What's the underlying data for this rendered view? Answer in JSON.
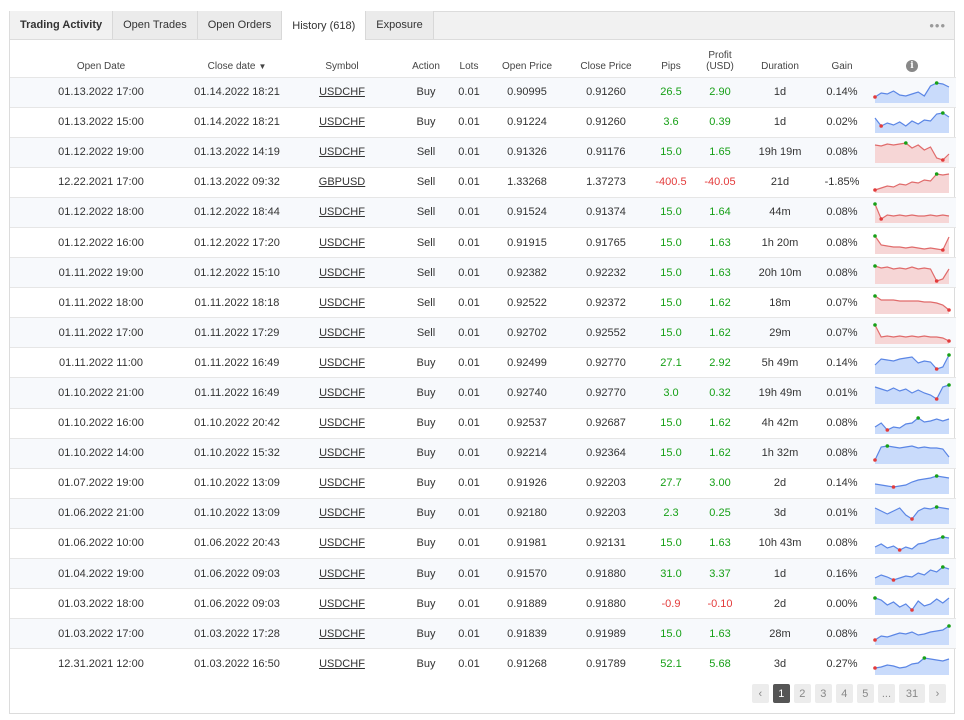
{
  "tabs": [
    {
      "label": "Trading Activity"
    },
    {
      "label": "Open Trades"
    },
    {
      "label": "Open Orders"
    },
    {
      "label": "History (618)"
    },
    {
      "label": "Exposure"
    }
  ],
  "more_label": "•••",
  "columns": {
    "open_date": "Open Date",
    "close_date": "Close date",
    "sort_caret": "▼",
    "symbol": "Symbol",
    "action": "Action",
    "lots": "Lots",
    "open_price": "Open Price",
    "close_price": "Close Price",
    "pips": "Pips",
    "profit_line1": "Profit",
    "profit_line2": "(USD)",
    "duration": "Duration",
    "gain": "Gain",
    "info_icon": "i"
  },
  "colors": {
    "positive": "#17a017",
    "negative": "#e33b3b",
    "buy_fill": "#c9dbfb",
    "buy_line": "#5b86e5",
    "sell_fill": "#f6d6d6",
    "sell_line": "#e06b6b"
  },
  "rows": [
    {
      "open": "01.13.2022 17:00",
      "close": "01.14.2022 18:21",
      "symbol": "USDCHF",
      "action": "Buy",
      "lots": "0.01",
      "open_price": "0.90995",
      "close_price": "0.91260",
      "pips": "26.5",
      "profit": "2.90",
      "duration": "1d",
      "gain": "0.14%",
      "spark": [
        0.25,
        0.45,
        0.4,
        0.55,
        0.35,
        0.3,
        0.4,
        0.5,
        0.3,
        0.8,
        0.95,
        0.9,
        0.75
      ]
    },
    {
      "open": "01.13.2022 15:00",
      "close": "01.14.2022 18:21",
      "symbol": "USDCHF",
      "action": "Buy",
      "lots": "0.01",
      "open_price": "0.91224",
      "close_price": "0.91260",
      "pips": "3.6",
      "profit": "0.39",
      "duration": "1d",
      "gain": "0.02%",
      "spark": [
        0.7,
        0.3,
        0.45,
        0.35,
        0.5,
        0.3,
        0.55,
        0.4,
        0.6,
        0.55,
        0.9,
        0.95,
        0.75
      ]
    },
    {
      "open": "01.12.2022 19:00",
      "close": "01.13.2022 14:19",
      "symbol": "USDCHF",
      "action": "Sell",
      "lots": "0.01",
      "open_price": "0.91326",
      "close_price": "0.91176",
      "pips": "15.0",
      "profit": "1.65",
      "duration": "19h 19m",
      "gain": "0.08%",
      "spark": [
        0.85,
        0.8,
        0.9,
        0.85,
        0.9,
        0.95,
        0.7,
        0.85,
        0.6,
        0.75,
        0.2,
        0.1,
        0.4
      ]
    },
    {
      "open": "12.22.2021 17:00",
      "close": "01.13.2022 09:32",
      "symbol": "GBPUSD",
      "action": "Sell",
      "lots": "0.01",
      "open_price": "1.33268",
      "close_price": "1.37273",
      "pips": "-400.5",
      "profit": "-40.05",
      "duration": "21d",
      "gain": "-1.85%",
      "spark": [
        0.1,
        0.2,
        0.3,
        0.25,
        0.4,
        0.35,
        0.5,
        0.45,
        0.6,
        0.55,
        0.9,
        0.85,
        0.9
      ]
    },
    {
      "open": "01.12.2022 18:00",
      "close": "01.12.2022 18:44",
      "symbol": "USDCHF",
      "action": "Sell",
      "lots": "0.01",
      "open_price": "0.91524",
      "close_price": "0.91374",
      "pips": "15.0",
      "profit": "1.64",
      "duration": "44m",
      "gain": "0.08%",
      "spark": [
        0.9,
        0.15,
        0.35,
        0.3,
        0.35,
        0.3,
        0.35,
        0.3,
        0.3,
        0.35,
        0.3,
        0.35,
        0.3
      ]
    },
    {
      "open": "01.12.2022 16:00",
      "close": "01.12.2022 17:20",
      "symbol": "USDCHF",
      "action": "Sell",
      "lots": "0.01",
      "open_price": "0.91915",
      "close_price": "0.91765",
      "pips": "15.0",
      "profit": "1.63",
      "duration": "1h 20m",
      "gain": "0.08%",
      "spark": [
        0.85,
        0.4,
        0.35,
        0.3,
        0.3,
        0.25,
        0.3,
        0.25,
        0.2,
        0.25,
        0.2,
        0.15,
        0.8
      ]
    },
    {
      "open": "01.11.2022 19:00",
      "close": "01.12.2022 15:10",
      "symbol": "USDCHF",
      "action": "Sell",
      "lots": "0.01",
      "open_price": "0.92382",
      "close_price": "0.92232",
      "pips": "15.0",
      "profit": "1.63",
      "duration": "20h 10m",
      "gain": "0.08%",
      "spark": [
        0.85,
        0.75,
        0.8,
        0.7,
        0.75,
        0.7,
        0.8,
        0.7,
        0.75,
        0.7,
        0.1,
        0.2,
        0.7
      ]
    },
    {
      "open": "01.11.2022 18:00",
      "close": "01.11.2022 18:18",
      "symbol": "USDCHF",
      "action": "Sell",
      "lots": "0.01",
      "open_price": "0.92522",
      "close_price": "0.92372",
      "pips": "15.0",
      "profit": "1.62",
      "duration": "18m",
      "gain": "0.07%",
      "spark": [
        0.85,
        0.65,
        0.65,
        0.65,
        0.6,
        0.6,
        0.6,
        0.6,
        0.55,
        0.55,
        0.5,
        0.4,
        0.15
      ]
    },
    {
      "open": "01.11.2022 17:00",
      "close": "01.11.2022 17:29",
      "symbol": "USDCHF",
      "action": "Sell",
      "lots": "0.01",
      "open_price": "0.92702",
      "close_price": "0.92552",
      "pips": "15.0",
      "profit": "1.62",
      "duration": "29m",
      "gain": "0.07%",
      "spark": [
        0.9,
        0.3,
        0.35,
        0.3,
        0.35,
        0.3,
        0.35,
        0.3,
        0.35,
        0.3,
        0.3,
        0.25,
        0.1
      ]
    },
    {
      "open": "01.11.2022 11:00",
      "close": "01.11.2022 16:49",
      "symbol": "USDCHF",
      "action": "Buy",
      "lots": "0.01",
      "open_price": "0.92499",
      "close_price": "0.92770",
      "pips": "27.1",
      "profit": "2.92",
      "duration": "5h 49m",
      "gain": "0.14%",
      "spark": [
        0.4,
        0.7,
        0.65,
        0.6,
        0.7,
        0.75,
        0.8,
        0.5,
        0.6,
        0.55,
        0.2,
        0.3,
        0.9
      ]
    },
    {
      "open": "01.10.2022 21:00",
      "close": "01.11.2022 16:49",
      "symbol": "USDCHF",
      "action": "Buy",
      "lots": "0.01",
      "open_price": "0.92740",
      "close_price": "0.92770",
      "pips": "3.0",
      "profit": "0.32",
      "duration": "19h 49m",
      "gain": "0.01%",
      "spark": [
        0.8,
        0.7,
        0.6,
        0.75,
        0.6,
        0.7,
        0.5,
        0.65,
        0.5,
        0.4,
        0.2,
        0.8,
        0.9
      ]
    },
    {
      "open": "01.10.2022 16:00",
      "close": "01.10.2022 20:42",
      "symbol": "USDCHF",
      "action": "Buy",
      "lots": "0.01",
      "open_price": "0.92537",
      "close_price": "0.92687",
      "pips": "15.0",
      "profit": "1.62",
      "duration": "4h 42m",
      "gain": "0.08%",
      "spark": [
        0.3,
        0.5,
        0.15,
        0.3,
        0.25,
        0.45,
        0.5,
        0.75,
        0.55,
        0.6,
        0.7,
        0.6,
        0.7
      ]
    },
    {
      "open": "01.10.2022 14:00",
      "close": "01.10.2022 15:32",
      "symbol": "USDCHF",
      "action": "Buy",
      "lots": "0.01",
      "open_price": "0.92214",
      "close_price": "0.92364",
      "pips": "15.0",
      "profit": "1.62",
      "duration": "1h 32m",
      "gain": "0.08%",
      "spark": [
        0.15,
        0.8,
        0.85,
        0.8,
        0.75,
        0.8,
        0.85,
        0.75,
        0.8,
        0.75,
        0.75,
        0.7,
        0.3
      ]
    },
    {
      "open": "01.07.2022 19:00",
      "close": "01.10.2022 13:09",
      "symbol": "USDCHF",
      "action": "Buy",
      "lots": "0.01",
      "open_price": "0.91926",
      "close_price": "0.92203",
      "pips": "27.7",
      "profit": "3.00",
      "duration": "2d",
      "gain": "0.14%",
      "spark": [
        0.45,
        0.4,
        0.35,
        0.3,
        0.35,
        0.4,
        0.55,
        0.65,
        0.7,
        0.75,
        0.85,
        0.8,
        0.75
      ]
    },
    {
      "open": "01.06.2022 21:00",
      "close": "01.10.2022 13:09",
      "symbol": "USDCHF",
      "action": "Buy",
      "lots": "0.01",
      "open_price": "0.92180",
      "close_price": "0.92203",
      "pips": "2.3",
      "profit": "0.25",
      "duration": "3d",
      "gain": "0.01%",
      "spark": [
        0.75,
        0.6,
        0.45,
        0.6,
        0.75,
        0.4,
        0.2,
        0.6,
        0.75,
        0.7,
        0.8,
        0.75,
        0.7
      ]
    },
    {
      "open": "01.06.2022 10:00",
      "close": "01.06.2022 20:43",
      "symbol": "USDCHF",
      "action": "Buy",
      "lots": "0.01",
      "open_price": "0.91981",
      "close_price": "0.92131",
      "pips": "15.0",
      "profit": "1.63",
      "duration": "10h 43m",
      "gain": "0.08%",
      "spark": [
        0.3,
        0.45,
        0.25,
        0.35,
        0.15,
        0.3,
        0.2,
        0.45,
        0.5,
        0.65,
        0.7,
        0.8,
        0.75
      ]
    },
    {
      "open": "01.04.2022 19:00",
      "close": "01.06.2022 09:03",
      "symbol": "USDCHF",
      "action": "Buy",
      "lots": "0.01",
      "open_price": "0.91570",
      "close_price": "0.91880",
      "pips": "31.0",
      "profit": "3.37",
      "duration": "1d",
      "gain": "0.16%",
      "spark": [
        0.3,
        0.45,
        0.35,
        0.2,
        0.3,
        0.4,
        0.35,
        0.55,
        0.45,
        0.7,
        0.6,
        0.85,
        0.75
      ]
    },
    {
      "open": "01.03.2022 18:00",
      "close": "01.06.2022 09:03",
      "symbol": "USDCHF",
      "action": "Buy",
      "lots": "0.01",
      "open_price": "0.91889",
      "close_price": "0.91880",
      "pips": "-0.9",
      "profit": "-0.10",
      "duration": "2d",
      "gain": "0.00%",
      "spark": [
        0.8,
        0.7,
        0.45,
        0.6,
        0.35,
        0.5,
        0.2,
        0.65,
        0.4,
        0.5,
        0.75,
        0.55,
        0.8
      ]
    },
    {
      "open": "01.03.2022 17:00",
      "close": "01.03.2022 17:28",
      "symbol": "USDCHF",
      "action": "Buy",
      "lots": "0.01",
      "open_price": "0.91839",
      "close_price": "0.91989",
      "pips": "15.0",
      "profit": "1.63",
      "duration": "28m",
      "gain": "0.08%",
      "spark": [
        0.2,
        0.4,
        0.35,
        0.45,
        0.55,
        0.5,
        0.6,
        0.45,
        0.5,
        0.6,
        0.65,
        0.7,
        0.9
      ]
    },
    {
      "open": "12.31.2021 12:00",
      "close": "01.03.2022 16:50",
      "symbol": "USDCHF",
      "action": "Buy",
      "lots": "0.01",
      "open_price": "0.91268",
      "close_price": "0.91789",
      "pips": "52.1",
      "profit": "5.68",
      "duration": "3d",
      "gain": "0.27%",
      "spark": [
        0.3,
        0.35,
        0.45,
        0.4,
        0.3,
        0.35,
        0.5,
        0.55,
        0.8,
        0.75,
        0.7,
        0.65,
        0.75
      ]
    }
  ],
  "pagination": {
    "prev": "‹",
    "pages": [
      "1",
      "2",
      "3",
      "4",
      "5",
      "...",
      "31"
    ],
    "active": "1",
    "next": "›"
  }
}
